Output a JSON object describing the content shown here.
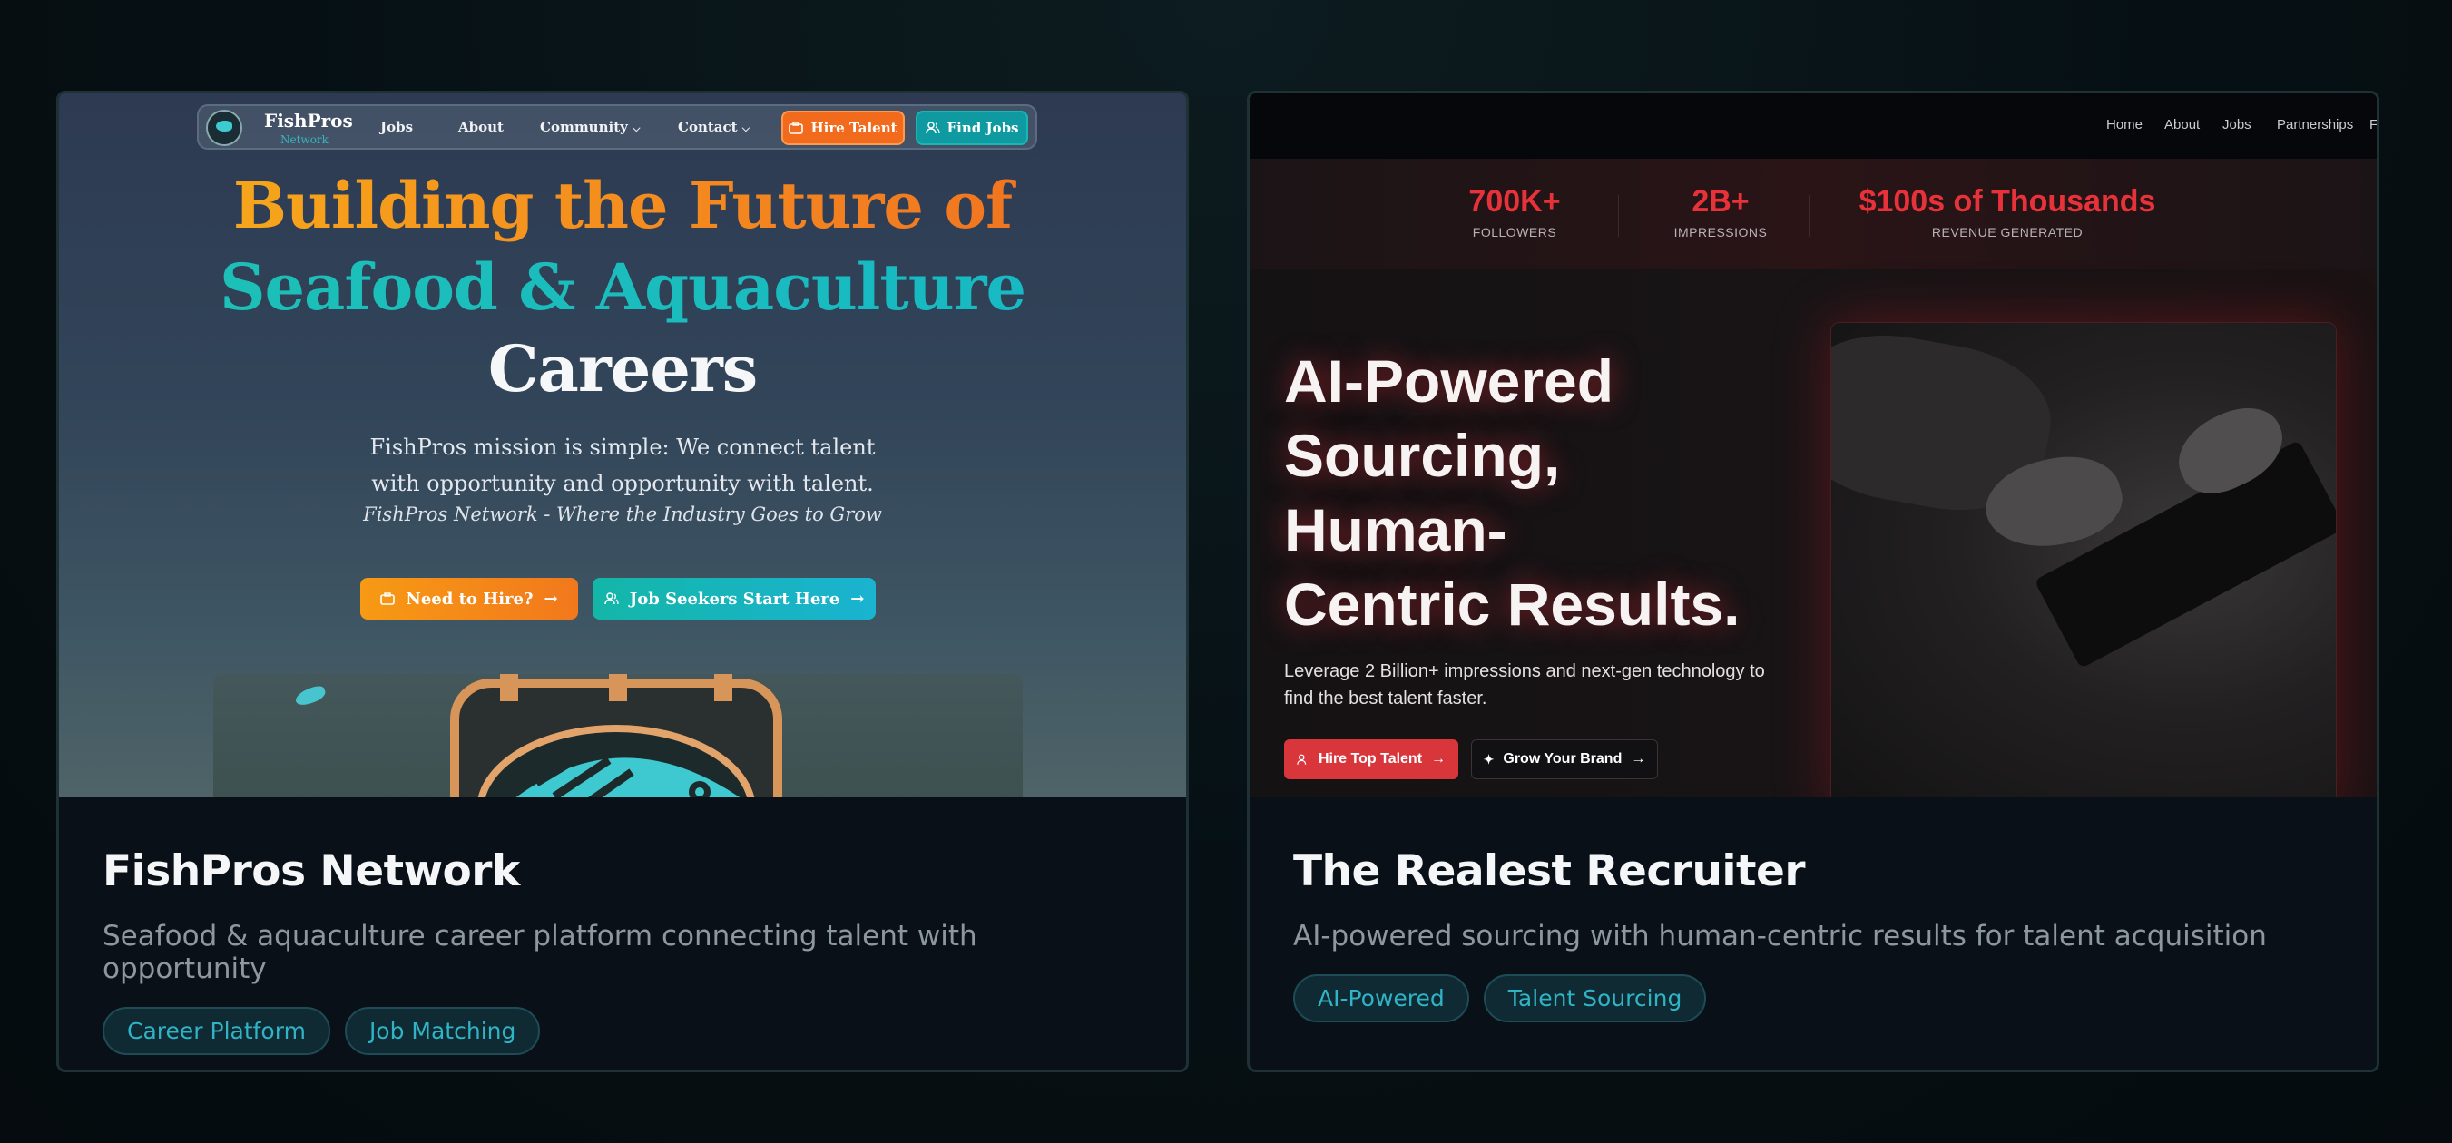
{
  "cards": [
    {
      "title": "FishPros Network",
      "description": "Seafood & aquaculture career platform connecting talent with opportunity",
      "tags": [
        "Career Platform",
        "Job Matching"
      ],
      "preview": {
        "brand": "FishPros",
        "brand_sub": "Network",
        "nav": [
          "Jobs",
          "About",
          "Community",
          "Contact"
        ],
        "hire_button": "Hire Talent",
        "find_button": "Find Jobs",
        "headline": [
          "Building the Future of",
          "Seafood & Aquaculture",
          "Careers"
        ],
        "mission": "FishPros mission is simple: We connect talent with opportunity and opportunity with talent.",
        "tagline": "FishPros Network - Where the Industry Goes to Grow",
        "cta_hire": "Need to Hire?",
        "cta_seekers": "Job Seekers Start Here",
        "colors": {
          "orange": "#f2781c",
          "teal": "#14b6a8"
        }
      }
    },
    {
      "title": "The Realest Recruiter",
      "description": "AI-powered sourcing with human-centric results for talent acquisition",
      "tags": [
        "AI-Powered",
        "Talent Sourcing"
      ],
      "preview": {
        "nav": [
          "Home",
          "About",
          "Jobs",
          "Partnerships",
          "F"
        ],
        "stats": [
          {
            "value": "700K+",
            "label": "FOLLOWERS"
          },
          {
            "value": "2B+",
            "label": "IMPRESSIONS"
          },
          {
            "value": "$100s of Thousands",
            "label": "REVENUE GENERATED"
          }
        ],
        "headline": [
          "AI-Powered",
          "Sourcing,",
          "Human-",
          "Centric Results."
        ],
        "subtext": "Leverage 2 Billion+ impressions and next-gen technology to find the best talent faster.",
        "cta_primary": "Hire Top Talent",
        "cta_secondary": "Grow Your Brand",
        "colors": {
          "accent": "#d9363c"
        }
      }
    }
  ]
}
